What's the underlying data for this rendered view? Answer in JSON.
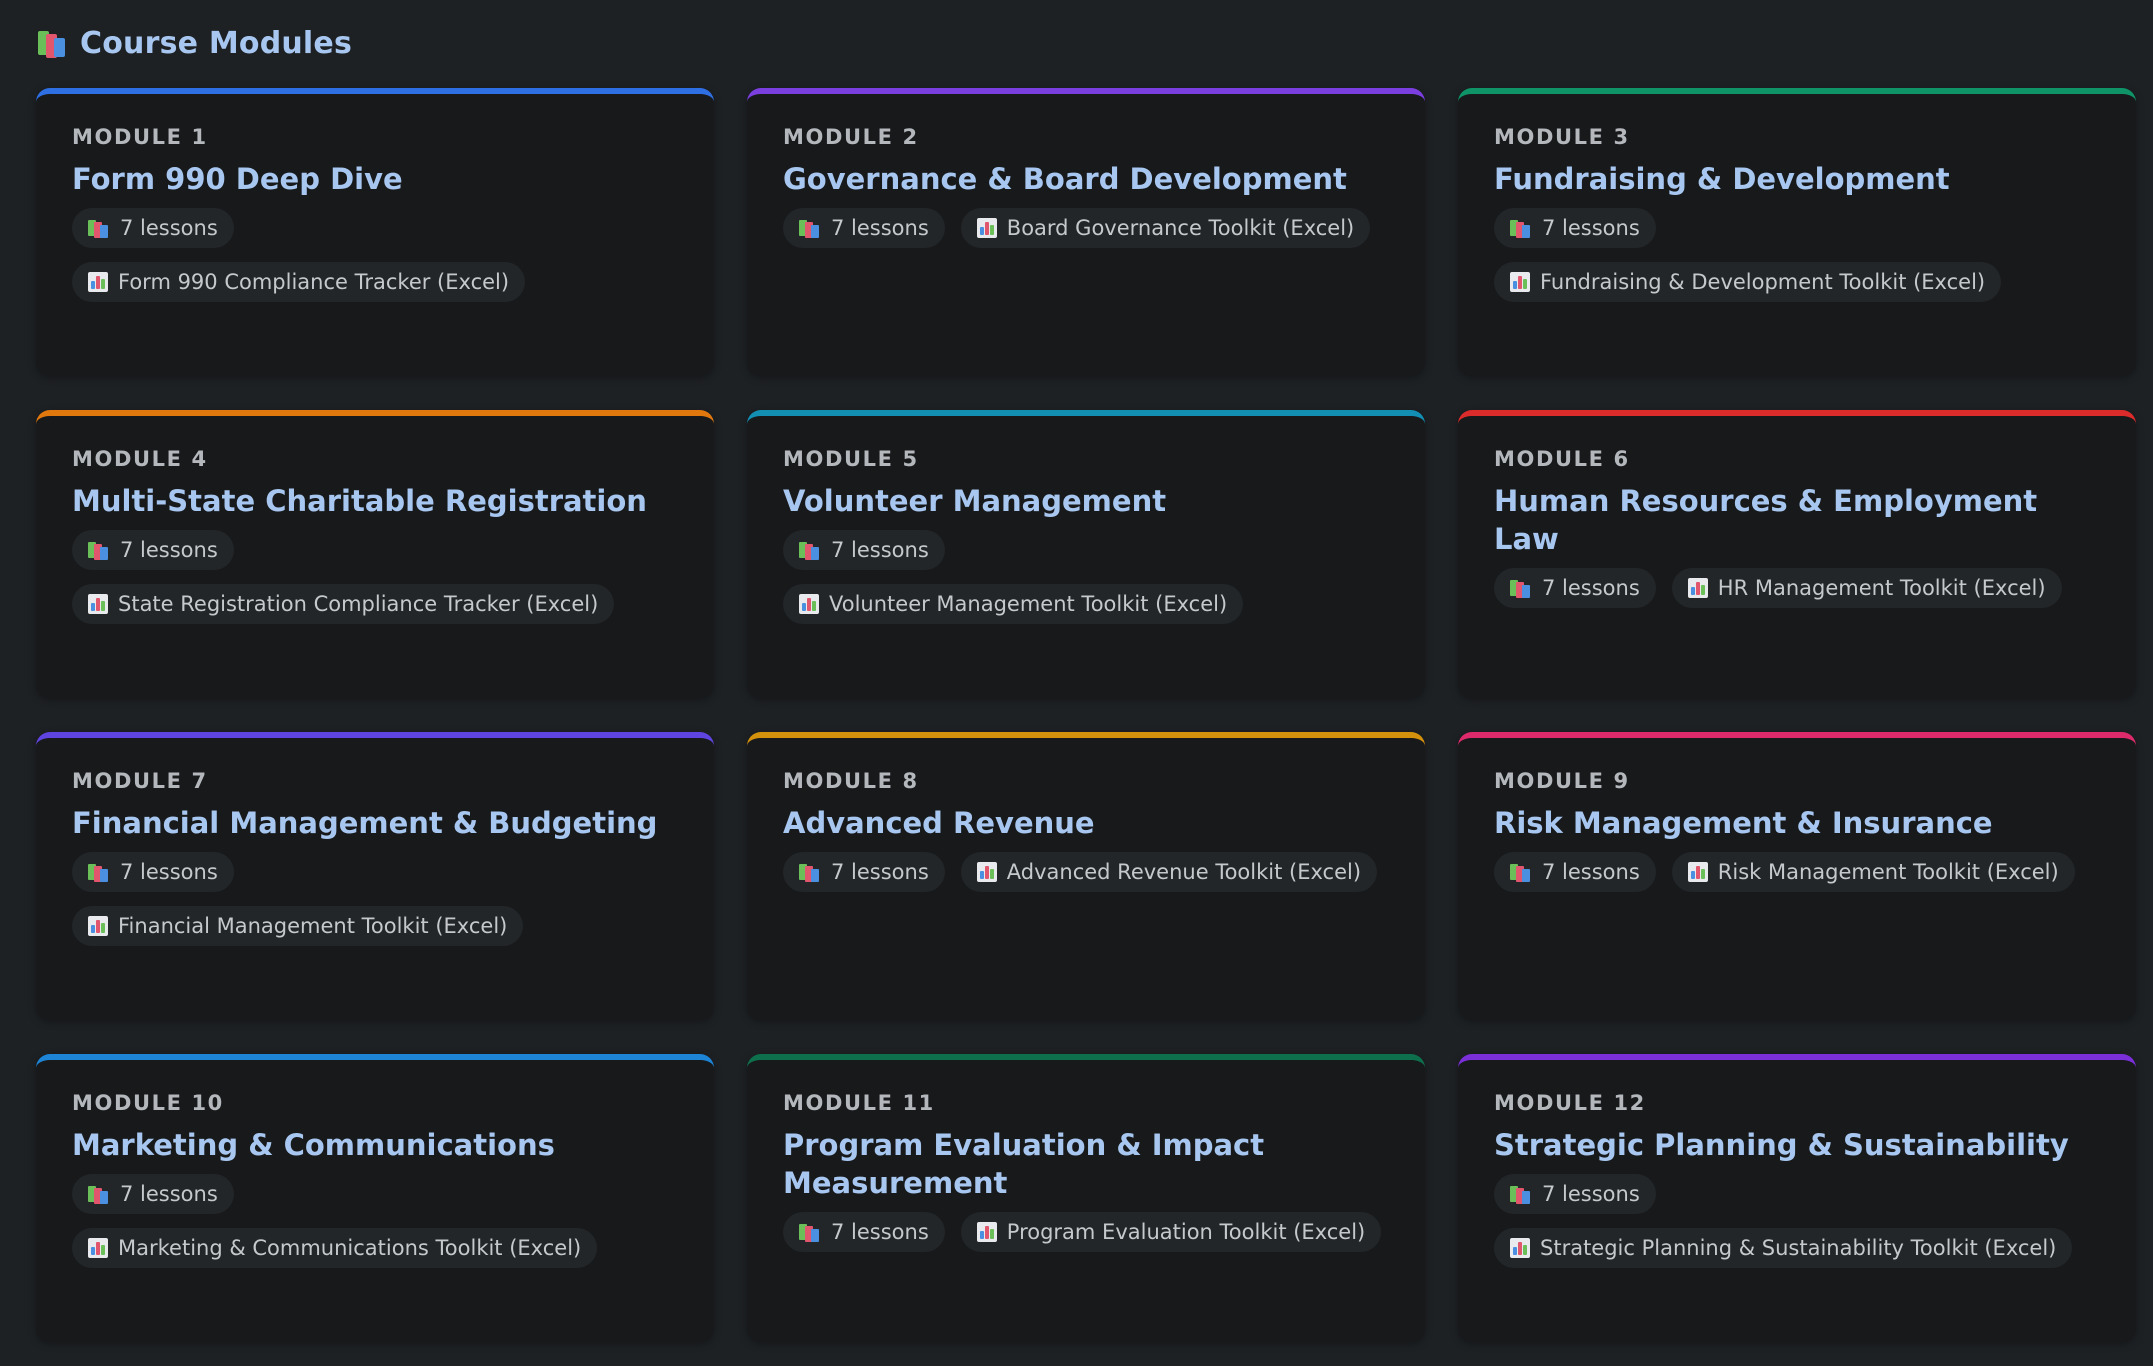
{
  "header": {
    "title": "Course Modules",
    "icon": "books-icon"
  },
  "modules": [
    {
      "label": "MODULE 1",
      "title": "Form 990 Deep Dive",
      "accent": "#2f6fe4",
      "lessons": "7 lessons",
      "toolkit": "Form 990 Compliance Tracker (Excel)"
    },
    {
      "label": "MODULE 2",
      "title": "Governance & Board Development",
      "accent": "#7b3fe0",
      "lessons": "7 lessons",
      "toolkit": "Board Governance Toolkit (Excel)"
    },
    {
      "label": "MODULE 3",
      "title": "Fundraising & Development",
      "accent": "#0e9467",
      "lessons": "7 lessons",
      "toolkit": "Fundraising & Development Toolkit (Excel)"
    },
    {
      "label": "MODULE 4",
      "title": "Multi-State Charitable Registration",
      "accent": "#e0780e",
      "lessons": "7 lessons",
      "toolkit": "State Registration Compliance Tracker (Excel)"
    },
    {
      "label": "MODULE 5",
      "title": "Volunteer Management",
      "accent": "#138fb3",
      "lessons": "7 lessons",
      "toolkit": "Volunteer Management Toolkit (Excel)"
    },
    {
      "label": "MODULE 6",
      "title": "Human Resources & Employment Law",
      "accent": "#dc2b2b",
      "lessons": "7 lessons",
      "toolkit": "HR Management Toolkit (Excel)"
    },
    {
      "label": "MODULE 7",
      "title": "Financial Management & Budgeting",
      "accent": "#5f44e0",
      "lessons": "7 lessons",
      "toolkit": "Financial Management Toolkit (Excel)"
    },
    {
      "label": "MODULE 8",
      "title": "Advanced Revenue",
      "accent": "#d4910c",
      "lessons": "7 lessons",
      "toolkit": "Advanced Revenue Toolkit (Excel)"
    },
    {
      "label": "MODULE 9",
      "title": "Risk Management & Insurance",
      "accent": "#dc2a6a",
      "lessons": "7 lessons",
      "toolkit": "Risk Management Toolkit (Excel)"
    },
    {
      "label": "MODULE 10",
      "title": "Marketing & Communications",
      "accent": "#1e84d6",
      "lessons": "7 lessons",
      "toolkit": "Marketing & Communications Toolkit (Excel)"
    },
    {
      "label": "MODULE 11",
      "title": "Program Evaluation & Impact Measurement",
      "accent": "#0d6f4c",
      "lessons": "7 lessons",
      "toolkit": "Program Evaluation Toolkit (Excel)"
    },
    {
      "label": "MODULE 12",
      "title": "Strategic Planning & Sustainability",
      "accent": "#7a2fd8",
      "lessons": "7 lessons",
      "toolkit": "Strategic Planning & Sustainability Toolkit (Excel)"
    }
  ]
}
